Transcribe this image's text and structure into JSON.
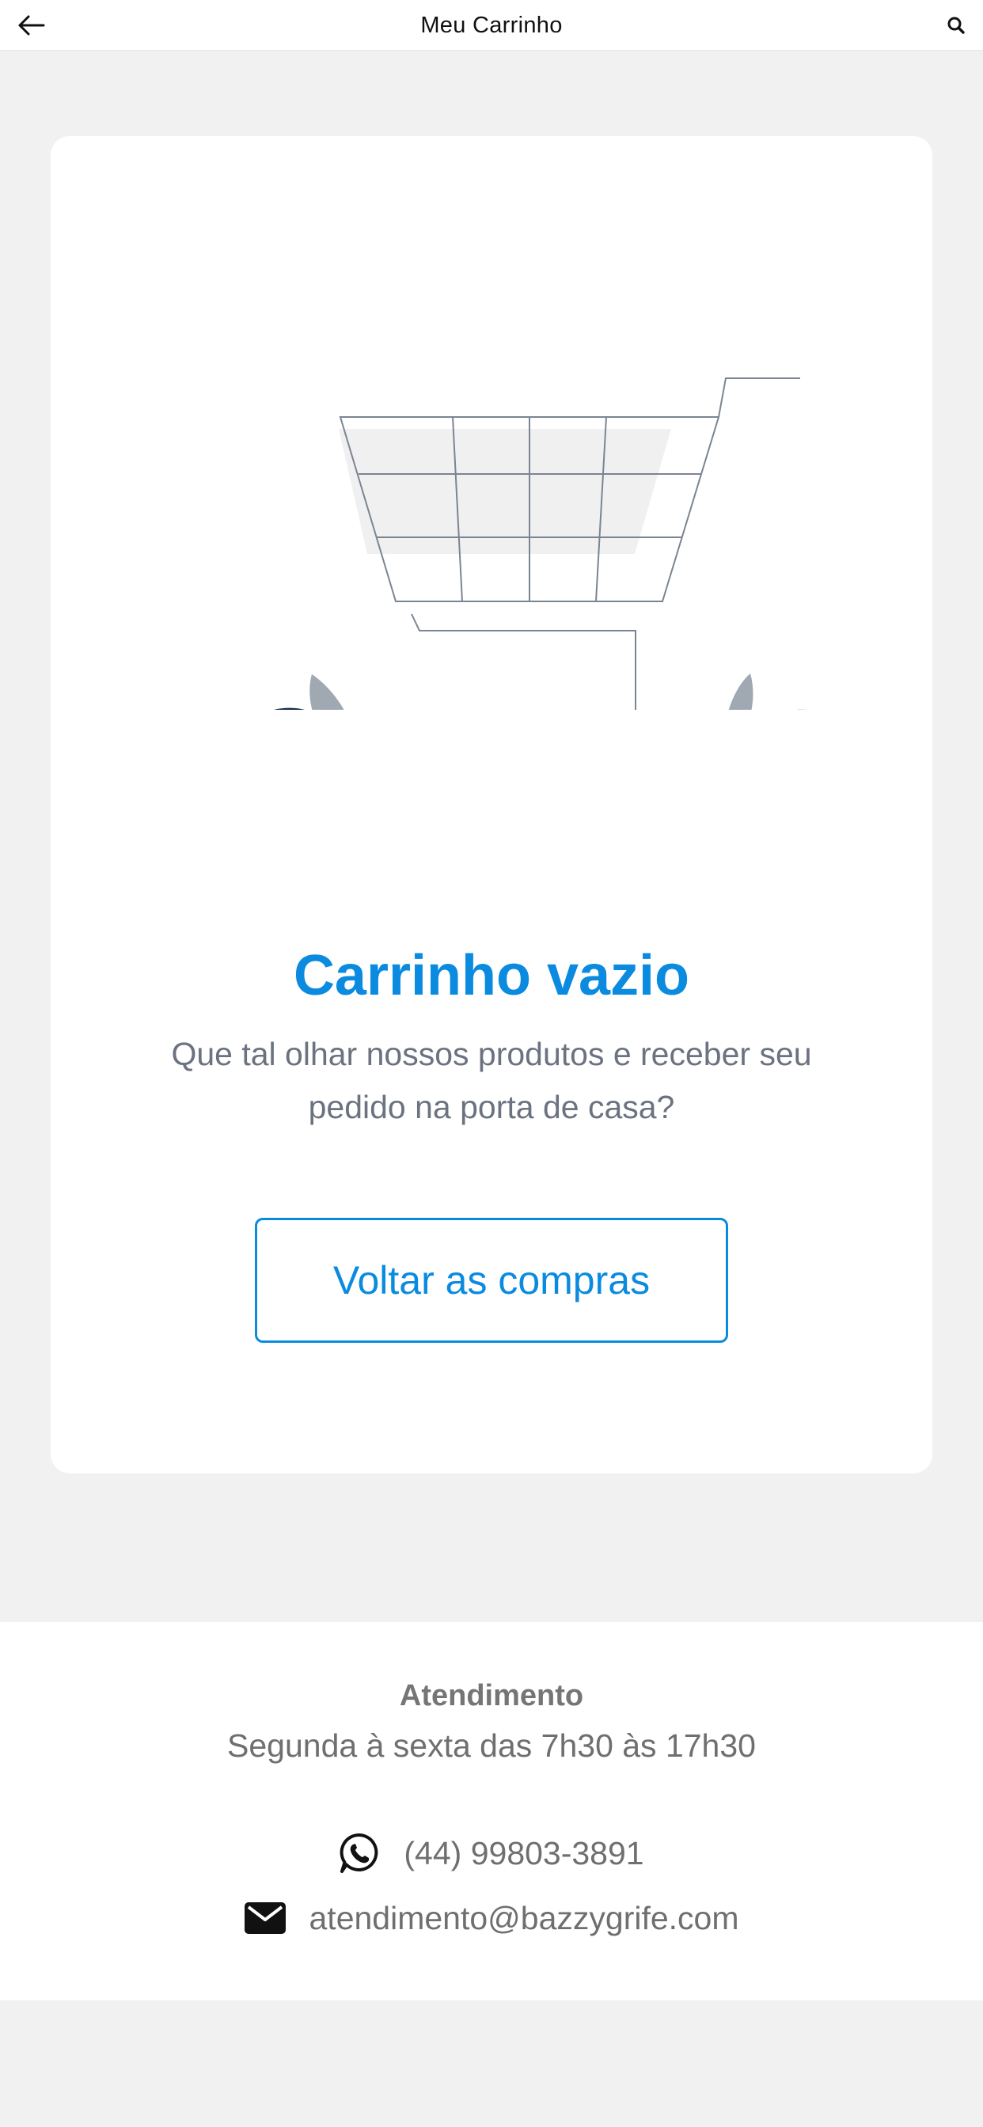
{
  "header": {
    "title": "Meu Carrinho",
    "back_icon": "arrow-left-icon",
    "search_icon": "search-icon"
  },
  "empty_state": {
    "illustration": "empty-shopping-cart-illustration",
    "title": "Carrinho vazio",
    "subtitle": "Que tal olhar nossos produtos e receber seu pedido na porta de casa?",
    "button_label": "Voltar as compras"
  },
  "footer": {
    "heading": "Atendimento",
    "hours": "Segunda à sexta das 7h30 às 17h30",
    "phone": "(44) 99803-3891",
    "phone_icon": "whatsapp-icon",
    "email": "atendimento@bazzygrife.com",
    "email_icon": "envelope-icon"
  },
  "colors": {
    "accent": "#0a8be0",
    "background": "#f1f1f1",
    "card": "#ffffff",
    "leaf_dark": "#142c4a",
    "leaf_light": "#a0a8b2",
    "cart_stroke": "#7a8593"
  }
}
